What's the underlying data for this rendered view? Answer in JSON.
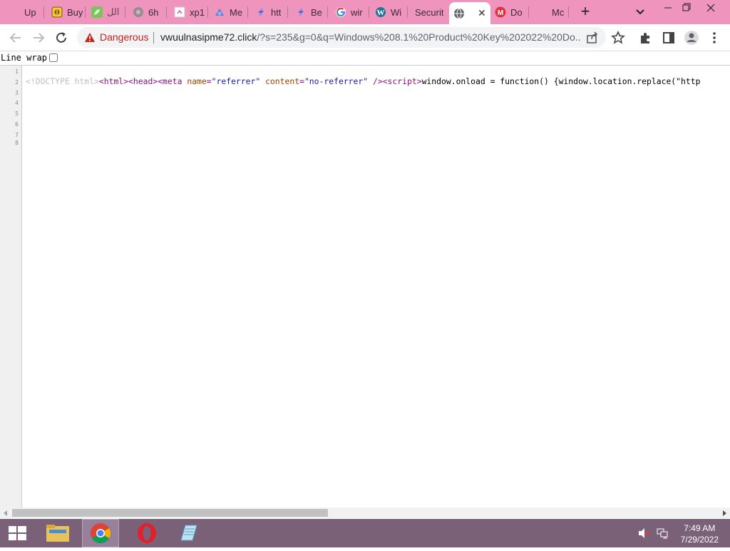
{
  "tabs": [
    {
      "label": "Up",
      "favicon": "pink-blank-favicon"
    },
    {
      "label": "Buy",
      "favicon": "yellow-shield-favicon"
    },
    {
      "label": "الل",
      "favicon": "green-leaf-favicon"
    },
    {
      "label": "6h",
      "favicon": "gray-circle-favicon"
    },
    {
      "label": "xp1",
      "favicon": "document-favicon"
    },
    {
      "label": "Me",
      "favicon": "blue-people-favicon"
    },
    {
      "label": "htt",
      "favicon": "blue-feather-favicon"
    },
    {
      "label": "Be",
      "favicon": "blue-feather-favicon"
    },
    {
      "label": "wir",
      "favicon": "google-g-favicon"
    },
    {
      "label": "Wi",
      "favicon": "wordpress-favicon"
    },
    {
      "label": "Securit",
      "favicon": ""
    },
    {
      "label": "",
      "favicon": "globe-favicon",
      "active": true
    },
    {
      "label": "Do",
      "favicon": "red-m-favicon"
    },
    {
      "label": "Mc",
      "favicon": ""
    }
  ],
  "omnibox": {
    "security_label": "Dangerous",
    "url_domain": "vwuulnasipme72.click",
    "url_rest": "/?s=235&g=0&q=Windows%208.1%20Product%20Key%202022%20Do..."
  },
  "viewsource": {
    "line_wrap_label": "Line wrap",
    "line_wrap_checked": false,
    "line_numbers": [
      "1",
      "2",
      "3",
      "4",
      "5",
      "6",
      "7",
      "8"
    ],
    "line2": {
      "doctype": "<!DOCTYPE html>",
      "html_open": "<html>",
      "head_open": "<head>",
      "meta_open": "<meta",
      "attr_name": "name",
      "attr_name_val": "\"referrer\"",
      "attr_content": "content",
      "attr_content_val": "\"no-referrer\"",
      "meta_close": "/>",
      "script_open": "<script>",
      "script_text": "window.onload = function() {window.location.replace(\"http"
    }
  },
  "taskbar": {
    "time": "7:49 AM",
    "date": "7/29/2022",
    "apps": [
      "file-explorer",
      "chrome",
      "opera",
      "notepad"
    ]
  },
  "colors": {
    "tabbar": "#ef95bd",
    "danger": "#c5221f",
    "taskbar": "#7b6178"
  }
}
